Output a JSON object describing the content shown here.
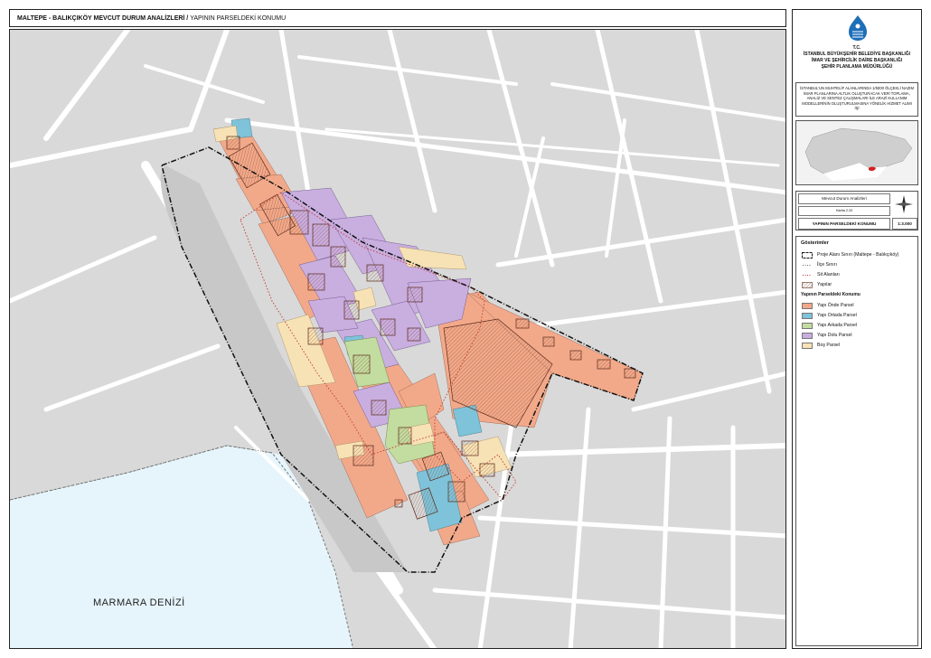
{
  "header": {
    "title": "MALTEPE - BALIKÇIKÖY MEVCUT DURUM ANALİZLERİ /",
    "subtitle": "YAPININ PARSELDEKİ KONUMU"
  },
  "institution": {
    "tc": "T.C.",
    "line1": "İSTANBUL BÜYÜKŞEHİR BELEDİYE BAŞKANLIĞI",
    "line2": "İMAR VE ŞEHİRCİLİK DAİRE BAŞKANLIĞI",
    "line3": "ŞEHİR PLANLAMA MÜDÜRLÜĞÜ"
  },
  "project_description": "İSTANBUL'UN MUHTELİF ALANLARINDA 1/5000 ÖLÇEKLİ NAZIM İMAR PLANLARINA ALTLIK OLUŞTURACAK VERİ TOPLAMA, ANALİZ VE SENTEZ ÇALIŞMALARI İLE ARAZİ KULLANIM MODELLERİNİN OLUŞTURULMASINA YÖNELİK HİZMET ALIMI İŞİ",
  "sheet": {
    "series": "Mevcut Durum Analizleri",
    "map_no": "Harita 2.20",
    "map_title": "YAPININ PARSELDEKİ KONUMU",
    "scale": "1:3.000"
  },
  "legend": {
    "title": "Gösterimler",
    "items": [
      {
        "label": "Proje Alanı Sınırı (Maltepe - Balıkçıköy)",
        "symbol": "boundary"
      },
      {
        "label": "İlçe Sınırı",
        "symbol": "district"
      },
      {
        "label": "Sit Alanları",
        "symbol": "sit"
      },
      {
        "label": "Yapılar",
        "symbol": "hatch"
      }
    ],
    "category_title": "Yapının Parseldeki Konumu",
    "categories": [
      {
        "label": "Yapı Önde Parsel",
        "color": "#f2a98a"
      },
      {
        "label": "Yapı Ortada Parsel",
        "color": "#7ec3d9"
      },
      {
        "label": "Yapı Arkada Parsel",
        "color": "#c3dc9f"
      },
      {
        "label": "Yapı Dolu Parsel",
        "color": "#c9aee0"
      },
      {
        "label": "Boş Parsel",
        "color": "#f7e2b5"
      }
    ]
  },
  "map": {
    "sea_label": "MARMARA DENİZİ",
    "colors": {
      "street": "#ffffff",
      "block": "#d9d9d9",
      "sea": "#e6f5fc",
      "building_outline": "#5a2a1a"
    }
  }
}
